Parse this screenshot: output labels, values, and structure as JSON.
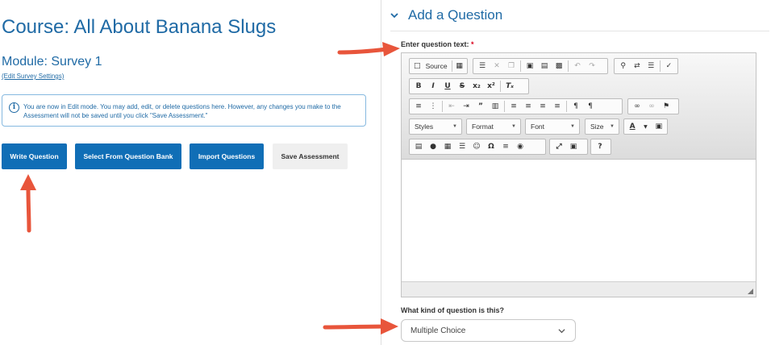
{
  "course": {
    "title": "Course: All About Banana Slugs"
  },
  "module": {
    "title": "Module: Survey 1",
    "edit_link": "(Edit Survey Settings)"
  },
  "info": {
    "icon": "info-icon",
    "text": "You are now in Edit mode. You may add, edit, or delete questions here. However, any changes you make to the Assessment will not be saved until you click \"Save Assessment.\""
  },
  "buttons": {
    "write": "Write Question",
    "bank": "Select From Question Bank",
    "import": "Import Questions",
    "save": "Save Assessment"
  },
  "add_question": {
    "title": "Add a Question",
    "question_label": "Enter question text:",
    "required_mark": "*"
  },
  "editor": {
    "source_label": "Source",
    "combos": {
      "styles": "Styles",
      "format": "Format",
      "font": "Font",
      "size": "Size"
    }
  },
  "question_kind": {
    "label": "What kind of question is this?",
    "selected": "Multiple Choice"
  },
  "colors": {
    "accent": "#1f6aa5",
    "primary_button": "#106eb6",
    "annotation_arrow": "#e8553b"
  }
}
